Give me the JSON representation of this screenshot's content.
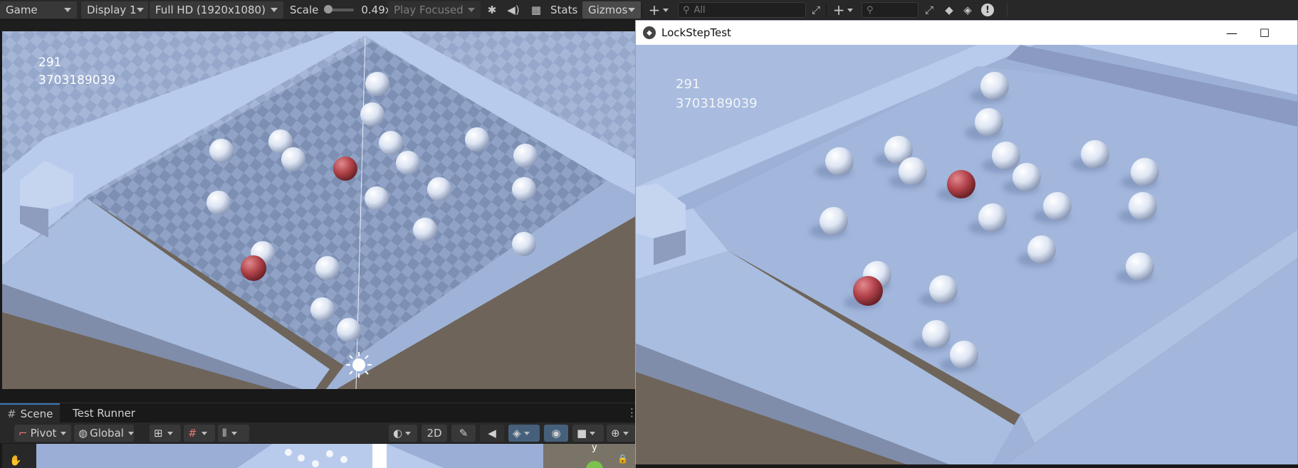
{
  "toolbar": {
    "view_mode": "Game",
    "display": "Display 1",
    "resolution": "Full HD (1920x1080)",
    "scale_label": "Scale",
    "scale_value": "0.49x",
    "play_mode": "Play Focused",
    "stats_label": "Stats",
    "gizmos_label": "Gizmos",
    "search_placeholder": "All"
  },
  "game_view": {
    "hud_line1": "291",
    "hud_line2": "3703189039"
  },
  "player_window": {
    "title": "LockStepTest",
    "hud_line1": "291",
    "hud_line2": "3703189039",
    "minimize_glyph": "—",
    "maximize_glyph": "☐"
  },
  "scene_panel": {
    "tabs": [
      {
        "label": "Scene"
      },
      {
        "label": "Test Runner"
      }
    ],
    "pivot_label": "Pivot",
    "global_label": "Global",
    "mode_2d_label": "2D",
    "axis_label": "y"
  },
  "colors": {
    "editor_bg": "#282828",
    "floor_light": "#9db1d6",
    "wall": "#a8bde0",
    "ground": "#6e6459",
    "red_ball": "#b2444b",
    "white_ball": "#e6ecf6"
  }
}
